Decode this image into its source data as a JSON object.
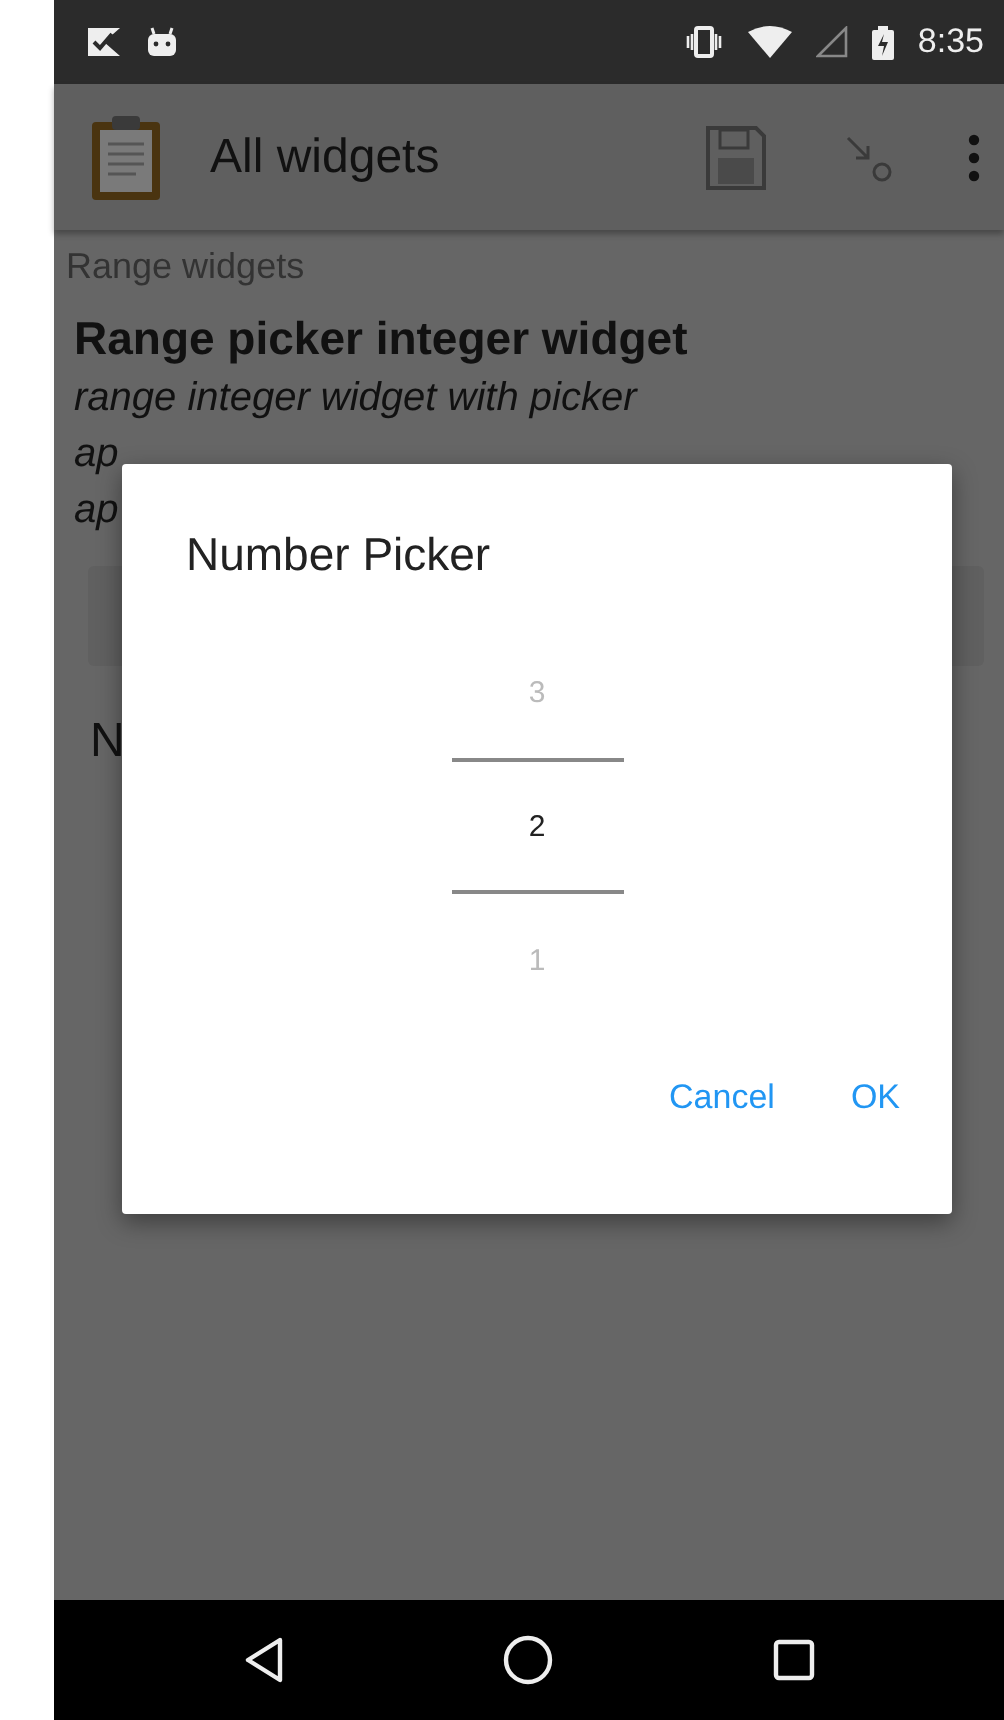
{
  "status_bar": {
    "time": "8:35"
  },
  "app_bar": {
    "title": "All widgets"
  },
  "content": {
    "group": "Range widgets",
    "question": "Range picker integer widget",
    "hint_lines": [
      "range integer widget with picker",
      "ap",
      "ap"
    ],
    "answer_fragment": "N"
  },
  "dialog": {
    "title": "Number Picker",
    "picker": [
      {
        "value": "3",
        "selected": false
      },
      {
        "value": "2",
        "selected": true
      },
      {
        "value": "1",
        "selected": false
      }
    ],
    "buttons": [
      "Cancel",
      "OK"
    ]
  }
}
